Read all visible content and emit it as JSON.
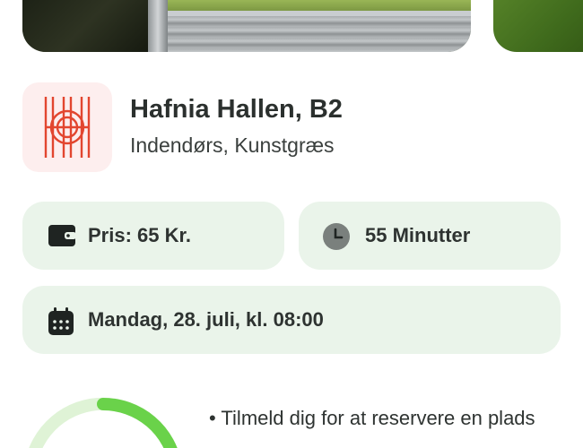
{
  "venue": {
    "name": "Hafnia Hallen, B2",
    "subtitle": "Indendørs, Kunstgræs"
  },
  "info": {
    "price": "Pris: 65 Kr.",
    "duration": "55 Minutter",
    "datetime": "Mandag, 28. juli, kl. 08:00"
  },
  "signup": {
    "bullet": "• Tilmeld dig for at reservere en plads"
  },
  "colors": {
    "accent_green": "#6ad24a",
    "pill_bg": "#eaf4ea",
    "logo_bg": "#fdeeee",
    "logo_red": "#e2462f"
  },
  "icons": {
    "price": "wallet-icon",
    "duration": "clock-icon",
    "date": "calendar-icon",
    "logo": "hafnia-logo-icon"
  }
}
